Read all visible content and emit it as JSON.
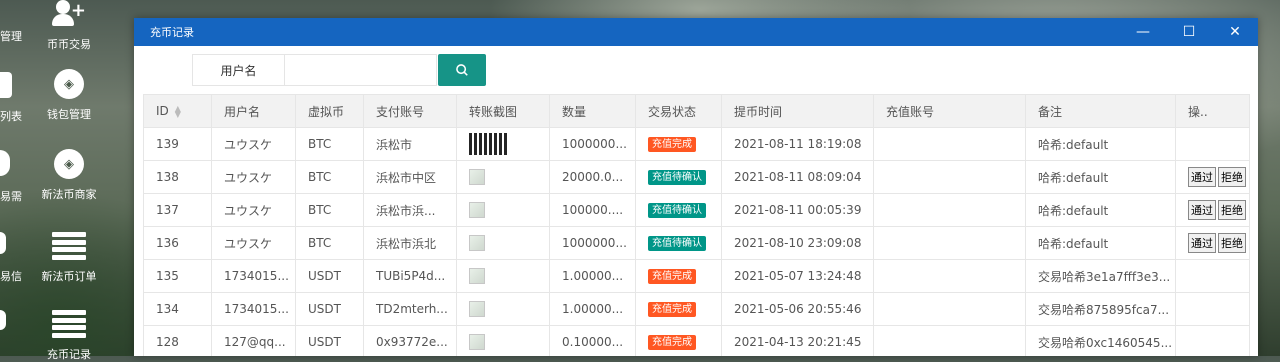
{
  "desktop": {
    "icons": [
      {
        "label": "币币交易",
        "icon": "user-plus-icon"
      },
      {
        "label": "钱包管理",
        "icon": "wallet-ring-icon"
      },
      {
        "label": "新法币商家",
        "icon": "merchant-ring-icon"
      },
      {
        "label": "新法币订单",
        "icon": "list-icon"
      },
      {
        "label": "充币记录",
        "icon": "list-icon"
      }
    ],
    "partial_labels": [
      "管理",
      "列表",
      "易需",
      "易信"
    ]
  },
  "window": {
    "title": "充币记录",
    "minimize": "—",
    "maximize": "☐",
    "close": "✕"
  },
  "search": {
    "label": "用户名",
    "value": "",
    "placeholder": "",
    "button_icon": "search-icon"
  },
  "table": {
    "columns": [
      "ID",
      "用户名",
      "虚拟币",
      "支付账号",
      "转账截图",
      "数量",
      "交易状态",
      "提币时间",
      "充值账号",
      "备注",
      "操.."
    ],
    "rows": [
      {
        "id": "139",
        "user": "ユウスケ",
        "coin": "BTC",
        "account": "浜松市",
        "screenshot": "qr",
        "amount": "1000000...",
        "status": "充值完成",
        "status_type": "done",
        "time": "2021-08-11 18:19:08",
        "recharge": "",
        "note": "哈希:default",
        "actions": []
      },
      {
        "id": "138",
        "user": "ユウスケ",
        "coin": "BTC",
        "account": "浜松市中区",
        "screenshot": "broken",
        "amount": "20000.0...",
        "status": "充值待确认",
        "status_type": "pending",
        "time": "2021-08-11 08:09:04",
        "recharge": "",
        "note": "哈希:default",
        "actions": [
          "通过",
          "拒绝"
        ]
      },
      {
        "id": "137",
        "user": "ユウスケ",
        "coin": "BTC",
        "account": "浜松市浜...",
        "screenshot": "broken",
        "amount": "100000....",
        "status": "充值待确认",
        "status_type": "pending",
        "time": "2021-08-11 00:05:39",
        "recharge": "",
        "note": "哈希:default",
        "actions": [
          "通过",
          "拒绝"
        ]
      },
      {
        "id": "136",
        "user": "ユウスケ",
        "coin": "BTC",
        "account": "浜松市浜北",
        "screenshot": "broken",
        "amount": "1000000...",
        "status": "充值待确认",
        "status_type": "pending",
        "time": "2021-08-10 23:09:08",
        "recharge": "",
        "note": "哈希:default",
        "actions": [
          "通过",
          "拒绝"
        ]
      },
      {
        "id": "135",
        "user": "1734015...",
        "coin": "USDT",
        "account": "TUBi5P4d...",
        "screenshot": "broken",
        "amount": "1.00000...",
        "status": "充值完成",
        "status_type": "done",
        "time": "2021-05-07 13:24:48",
        "recharge": "",
        "note": "交易哈希3e1a7fff3e3...",
        "actions": []
      },
      {
        "id": "134",
        "user": "1734015...",
        "coin": "USDT",
        "account": "TD2mterh...",
        "screenshot": "broken",
        "amount": "1.00000...",
        "status": "充值完成",
        "status_type": "done",
        "time": "2021-05-06 20:55:46",
        "recharge": "",
        "note": "交易哈希875895fca7...",
        "actions": []
      },
      {
        "id": "128",
        "user": "127@qq...",
        "coin": "USDT",
        "account": "0x93772e...",
        "screenshot": "broken",
        "amount": "0.10000...",
        "status": "充值完成",
        "status_type": "done",
        "time": "2021-04-13 20:21:45",
        "recharge": "",
        "note": "交易哈希0xc1460545...",
        "actions": []
      }
    ]
  },
  "colors": {
    "titlebar": "#1565c0",
    "search_button": "#169487",
    "done": "#ff5722",
    "pending": "#009688"
  }
}
